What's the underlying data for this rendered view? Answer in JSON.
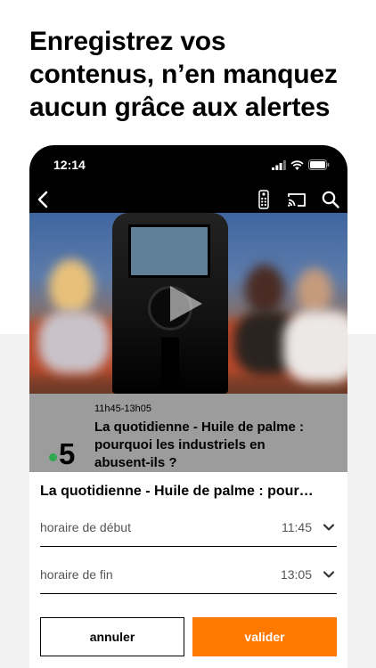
{
  "headline": {
    "line1": "Enregistrez vos",
    "line2": "contenus, n’en manquez",
    "line3": "aucun grâce aux alertes"
  },
  "status_bar": {
    "time": "12:14"
  },
  "nav": {
    "back_icon": "chevron-left-icon",
    "remote_icon": "remote-icon",
    "cast_icon": "cast-icon",
    "search_icon": "search-icon"
  },
  "program": {
    "time_range": "11h45-13h05",
    "title_line1": "La quotidienne - Huile de palme :",
    "title_line2": "pourquoi les industriels en",
    "title_line3": "abusent-ils ?",
    "channel": "5"
  },
  "sheet": {
    "title": "La quotidienne - Huile de palme : pour…",
    "start_label": "horaire de début",
    "start_value": "11:45",
    "end_label": "horaire de fin",
    "end_value": "13:05",
    "cancel_label": "annuler",
    "confirm_label": "valider"
  },
  "colors": {
    "accent": "#ff7900",
    "channel_dot": "#2fa84f",
    "program_bg": "#9c9c9c"
  }
}
